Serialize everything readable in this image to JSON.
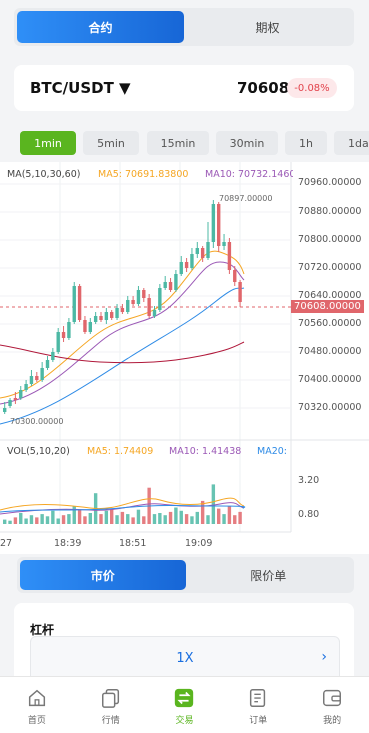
{
  "top_tabs": [
    {
      "label": "合约",
      "active": true
    },
    {
      "label": "期权",
      "active": false
    }
  ],
  "ticker": {
    "pair": "BTC/USDT ▼",
    "price": "70608",
    "change": "-0.08%"
  },
  "timeframes": [
    {
      "label": "1min",
      "active": true
    },
    {
      "label": "5min"
    },
    {
      "label": "15min"
    },
    {
      "label": "30min"
    },
    {
      "label": "1h"
    },
    {
      "label": "1da"
    }
  ],
  "indicators": {
    "ma_label": "MA(5,10,30,60)",
    "ma5": "MA5: 70691.83800",
    "ma10": "MA10: 70732.1460",
    "vol_label": "VOL(5,10,20)",
    "vol_ma5": "MA5: 1.74409",
    "vol_ma10": "MA10: 1.41438",
    "vol_ma20": "MA20: "
  },
  "price_axis": [
    "70960.00000",
    "70880.00000",
    "70800.00000",
    "70720.00000",
    "70640.00000",
    "70560.00000",
    "70480.00000",
    "70400.00000",
    "70320.00000"
  ],
  "current_price_tag": "70608.00000",
  "high_label": "70897.00000",
  "low_label": "70300.00000",
  "vol_axis": [
    "3.20",
    "0.80"
  ],
  "time_axis": [
    "27",
    "18:39",
    "18:51",
    "19:09"
  ],
  "order_tabs": [
    {
      "label": "市价",
      "active": true
    },
    {
      "label": "限价单",
      "active": false
    }
  ],
  "leverage": {
    "title": "杠杆",
    "value": "1X"
  },
  "colors": {
    "accent": "#1a6fe0",
    "green": "#4cb8a4",
    "red": "#e0666b",
    "ma5": "#f5a623",
    "ma10": "#9b59b6",
    "ma30": "#2e8be6",
    "ma60": "#b0183a"
  },
  "bottom_nav": [
    {
      "label": "首页",
      "icon": "home-icon"
    },
    {
      "label": "行情",
      "icon": "market-icon"
    },
    {
      "label": "交易",
      "icon": "trade-icon",
      "active": true
    },
    {
      "label": "订单",
      "icon": "orders-icon"
    },
    {
      "label": "我的",
      "icon": "wallet-icon"
    }
  ]
}
